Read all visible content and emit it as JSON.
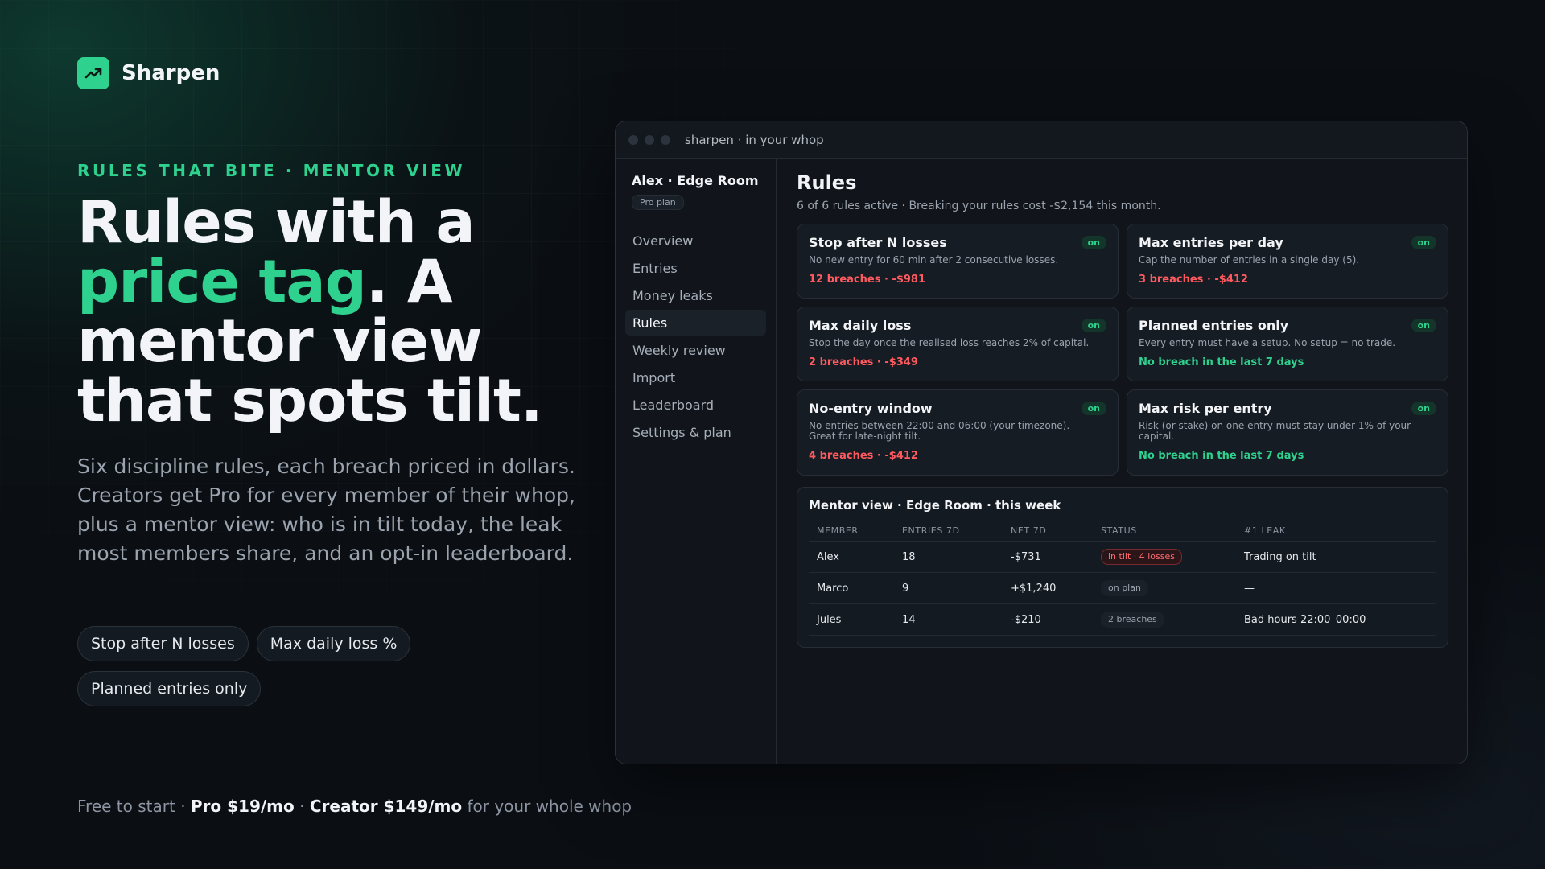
{
  "brand": {
    "name": "Sharpen",
    "icon": "trend-up-icon",
    "accent": "#2fd18e"
  },
  "hero": {
    "eyebrow": "RULES THAT BITE · MENTOR VIEW",
    "headline_1": "Rules with a ",
    "headline_accent": "price tag",
    "headline_2": ". A mentor view that spots tilt.",
    "subtext": "Six discipline rules, each breach priced in dollars. Creators get Pro for every member of their whop, plus a mentor view: who is in tilt today, the leak most members share, and an opt-in leaderboard.",
    "chips": [
      "Stop after N losses",
      "Max daily loss %",
      "Planned entries only"
    ]
  },
  "pricing": {
    "free": "Free to start",
    "sep": "·",
    "pro": "Pro $19/mo",
    "creator": "Creator $149/mo",
    "suffix": "for your whole whop"
  },
  "window": {
    "title": "sharpen · in your whop"
  },
  "sidebar": {
    "workspace": "Alex · Edge Room",
    "plan": "Pro plan",
    "items": [
      {
        "label": "Overview",
        "active": false
      },
      {
        "label": "Entries",
        "active": false
      },
      {
        "label": "Money leaks",
        "active": false
      },
      {
        "label": "Rules",
        "active": true
      },
      {
        "label": "Weekly review",
        "active": false
      },
      {
        "label": "Import",
        "active": false
      },
      {
        "label": "Leaderboard",
        "active": false
      },
      {
        "label": "Settings & plan",
        "active": false
      }
    ]
  },
  "main": {
    "title": "Rules",
    "subtitle": "6 of 6 rules active · Breaking your rules cost -$2,154 this month.",
    "rules": [
      {
        "title": "Stop after N losses",
        "desc": "No new entry for 60 min after 2 consecutive losses.",
        "stat": "12 breaches · -$981",
        "state": "bad",
        "toggle": "on"
      },
      {
        "title": "Max entries per day",
        "desc": "Cap the number of entries in a single day (5).",
        "stat": "3 breaches · -$412",
        "state": "bad",
        "toggle": "on"
      },
      {
        "title": "Max daily loss",
        "desc": "Stop the day once the realised loss reaches 2% of capital.",
        "stat": "2 breaches · -$349",
        "state": "bad",
        "toggle": "on"
      },
      {
        "title": "Planned entries only",
        "desc": "Every entry must have a setup. No setup = no trade.",
        "stat": "No breach in the last 7 days",
        "state": "good",
        "toggle": "on"
      },
      {
        "title": "No-entry window",
        "desc": "No entries between 22:00 and 06:00 (your timezone). Great for late-night tilt.",
        "stat": "4 breaches · -$412",
        "state": "bad",
        "toggle": "on"
      },
      {
        "title": "Max risk per entry",
        "desc": "Risk (or stake) on one entry must stay under 1% of your capital.",
        "stat": "No breach in the last 7 days",
        "state": "good",
        "toggle": "on"
      }
    ],
    "mentor": {
      "title": "Mentor view · Edge Room · this week",
      "columns": [
        "MEMBER",
        "ENTRIES 7D",
        "NET 7D",
        "STATUS",
        "#1 LEAK"
      ],
      "rows": [
        {
          "member": "Alex",
          "entries": "18",
          "net": "-$731",
          "net_sign": "neg",
          "status": "in tilt · 4 losses",
          "status_kind": "tilt",
          "leak": "Trading on tilt"
        },
        {
          "member": "Marco",
          "entries": "9",
          "net": "+$1,240",
          "net_sign": "pos",
          "status": "on plan",
          "status_kind": "plan",
          "leak": "—"
        },
        {
          "member": "Jules",
          "entries": "14",
          "net": "-$210",
          "net_sign": "neg",
          "status": "2 breaches",
          "status_kind": "breach",
          "leak": "Bad hours 22:00–00:00"
        }
      ]
    }
  }
}
